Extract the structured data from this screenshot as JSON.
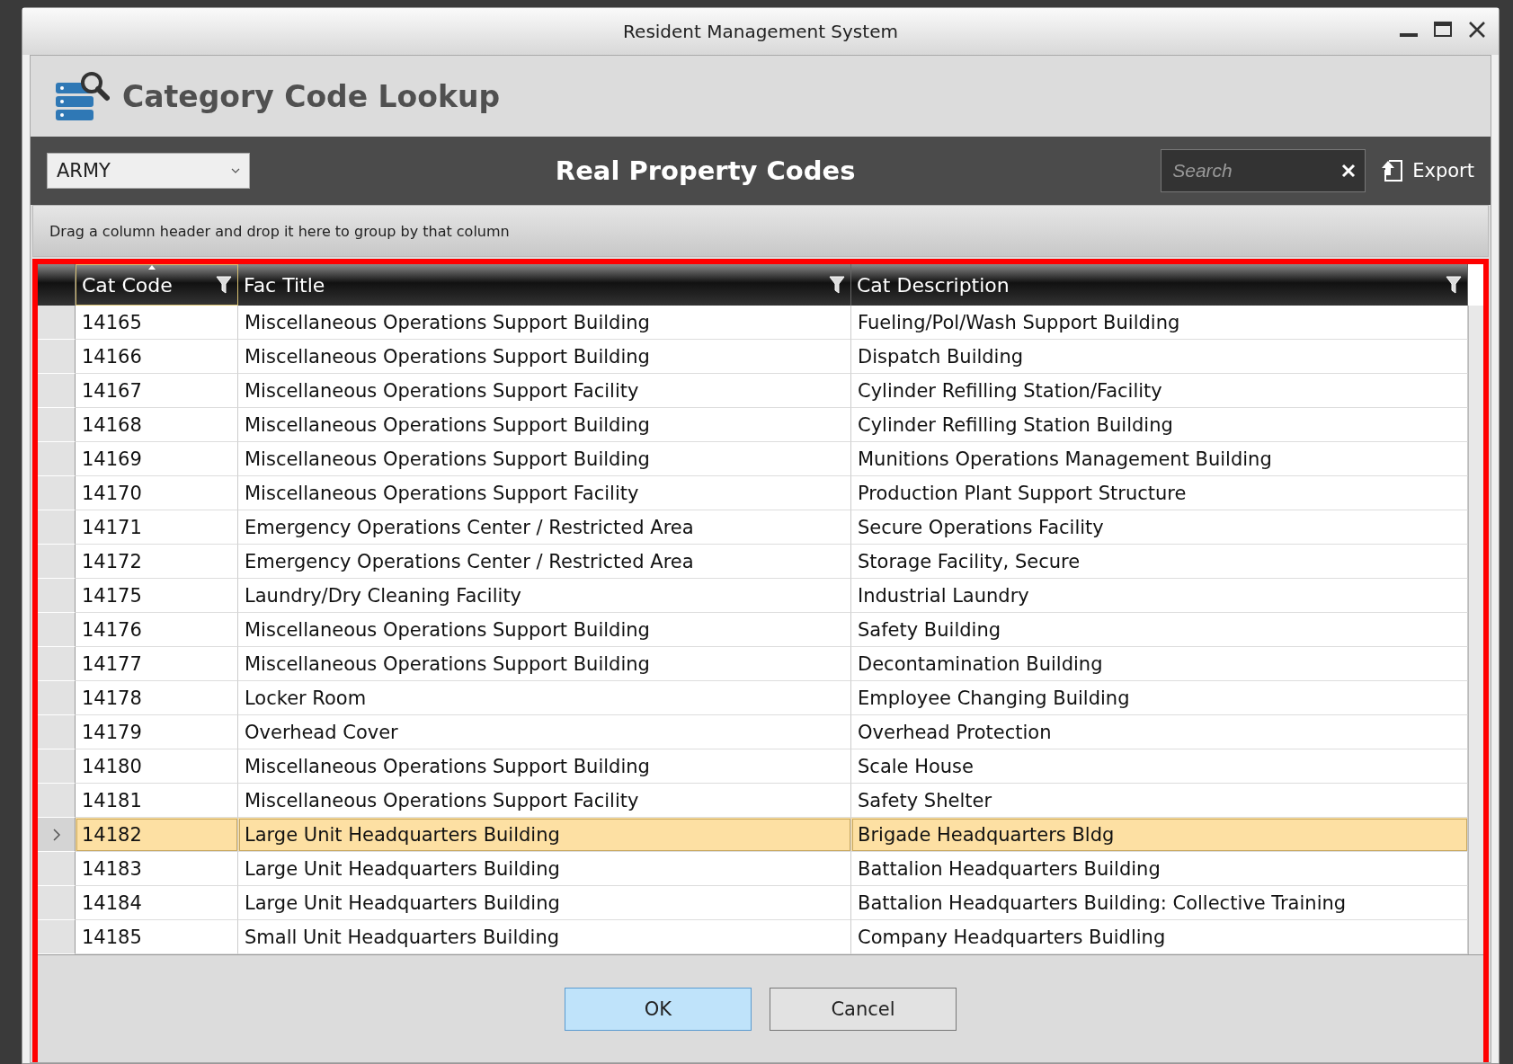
{
  "window": {
    "title": "Resident Management System"
  },
  "header": {
    "title": "Category Code Lookup"
  },
  "toolbar": {
    "dropdown": {
      "value": "ARMY"
    },
    "title": "Real Property Codes",
    "search": {
      "placeholder": "Search"
    },
    "export_button": "Export"
  },
  "group_panel": {
    "hint": "Drag a column header and drop it here to group by that column"
  },
  "table": {
    "columns": [
      {
        "label": "Cat Code",
        "sorted": true,
        "filter": true
      },
      {
        "label": "Fac Title",
        "sorted": false,
        "filter": true
      },
      {
        "label": "Cat Description",
        "sorted": false,
        "filter": true
      }
    ],
    "rows": [
      {
        "cells": [
          "14165",
          "Miscellaneous Operations Support Building",
          "Fueling/Pol/Wash Support Building"
        ],
        "selected": false
      },
      {
        "cells": [
          "14166",
          "Miscellaneous Operations Support Building",
          "Dispatch Building"
        ],
        "selected": false
      },
      {
        "cells": [
          "14167",
          "Miscellaneous Operations Support Facility",
          "Cylinder Refilling Station/Facility"
        ],
        "selected": false
      },
      {
        "cells": [
          "14168",
          "Miscellaneous Operations Support Building",
          "Cylinder Refilling Station Building"
        ],
        "selected": false
      },
      {
        "cells": [
          "14169",
          "Miscellaneous Operations Support Building",
          "Munitions Operations Management Building"
        ],
        "selected": false
      },
      {
        "cells": [
          "14170",
          "Miscellaneous Operations Support Facility",
          "Production Plant Support Structure"
        ],
        "selected": false
      },
      {
        "cells": [
          "14171",
          "Emergency Operations Center / Restricted Area",
          "Secure Operations Facility"
        ],
        "selected": false
      },
      {
        "cells": [
          "14172",
          "Emergency Operations Center / Restricted Area",
          "Storage Facility, Secure"
        ],
        "selected": false
      },
      {
        "cells": [
          "14175",
          "Laundry/Dry Cleaning Facility",
          "Industrial Laundry"
        ],
        "selected": false
      },
      {
        "cells": [
          "14176",
          "Miscellaneous Operations Support Building",
          "Safety Building"
        ],
        "selected": false
      },
      {
        "cells": [
          "14177",
          "Miscellaneous Operations Support Building",
          "Decontamination Building"
        ],
        "selected": false
      },
      {
        "cells": [
          "14178",
          "Locker Room",
          "Employee Changing Building"
        ],
        "selected": false
      },
      {
        "cells": [
          "14179",
          "Overhead Cover",
          "Overhead Protection"
        ],
        "selected": false
      },
      {
        "cells": [
          "14180",
          "Miscellaneous Operations Support Building",
          "Scale House"
        ],
        "selected": false
      },
      {
        "cells": [
          "14181",
          "Miscellaneous Operations Support Facility",
          "Safety Shelter"
        ],
        "selected": false
      },
      {
        "cells": [
          "14182",
          "Large Unit Headquarters Building",
          "Brigade Headquarters Bldg"
        ],
        "selected": true
      },
      {
        "cells": [
          "14183",
          "Large Unit Headquarters Building",
          "Battalion Headquarters Building"
        ],
        "selected": false
      },
      {
        "cells": [
          "14184",
          "Large Unit Headquarters Building",
          "Battalion Headquarters Building: Collective Training"
        ],
        "selected": false
      },
      {
        "cells": [
          "14185",
          "Small Unit Headquarters Building",
          "Company Headquarters Buidling"
        ],
        "selected": false
      }
    ]
  },
  "buttons": [
    {
      "label": "OK",
      "default": true
    },
    {
      "label": "Cancel",
      "default": false
    }
  ]
}
